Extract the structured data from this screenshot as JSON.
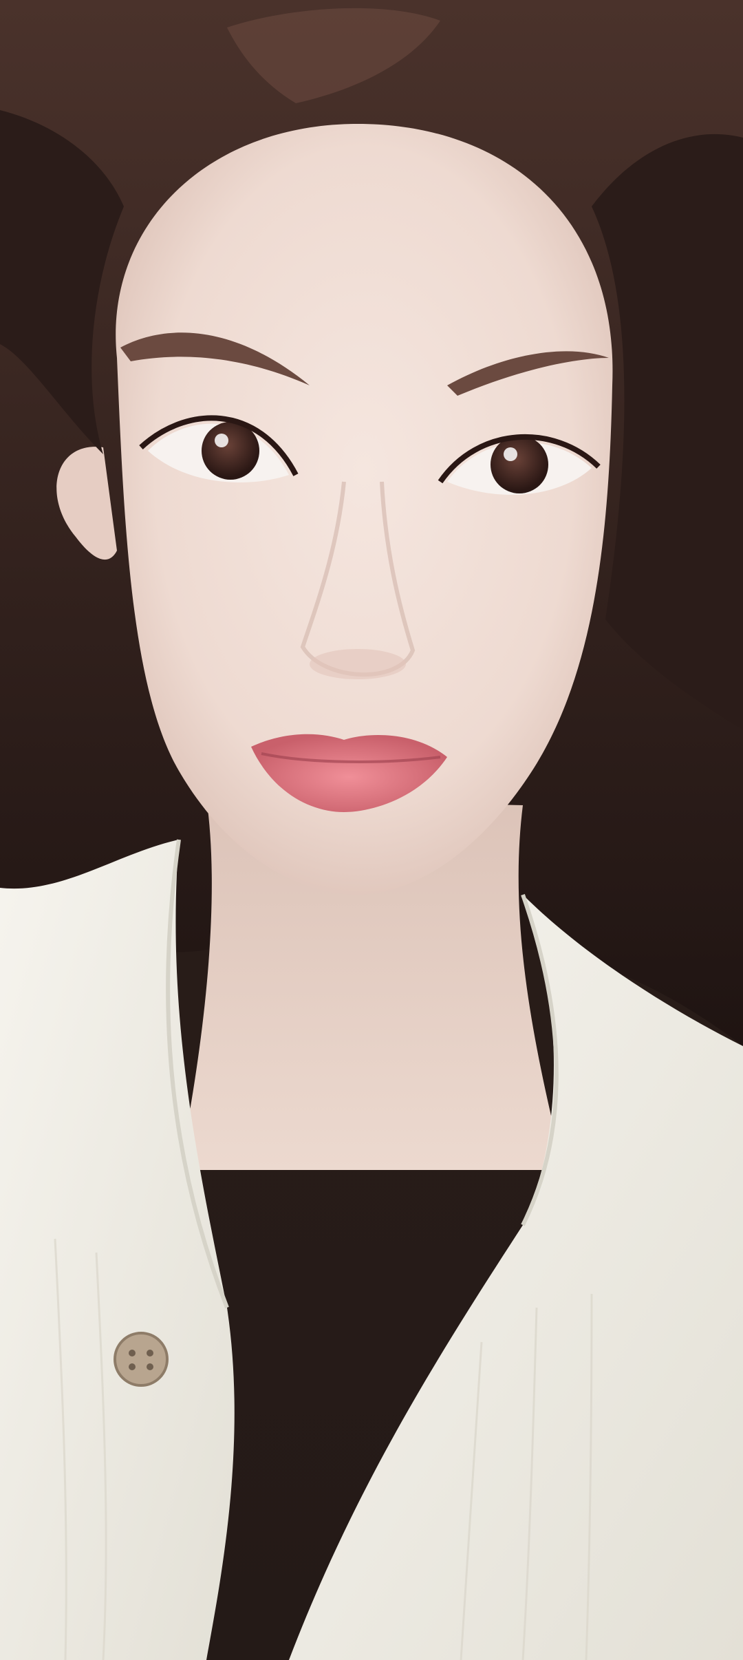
{
  "photo": {
    "kind": "selfie-portrait",
    "palette": {
      "hair": "#2b1c19",
      "hair_highlight": "#5a3a31",
      "skin": "#efdcd4",
      "skin_shadow": "#d8bfb5",
      "lips": "#d9727c",
      "iris": "#3a2420",
      "shirt": "#f3f1ea",
      "shirt_shadow": "#d9d6cc",
      "button": "#b8a58f",
      "background_light": "#e9e6df"
    }
  }
}
